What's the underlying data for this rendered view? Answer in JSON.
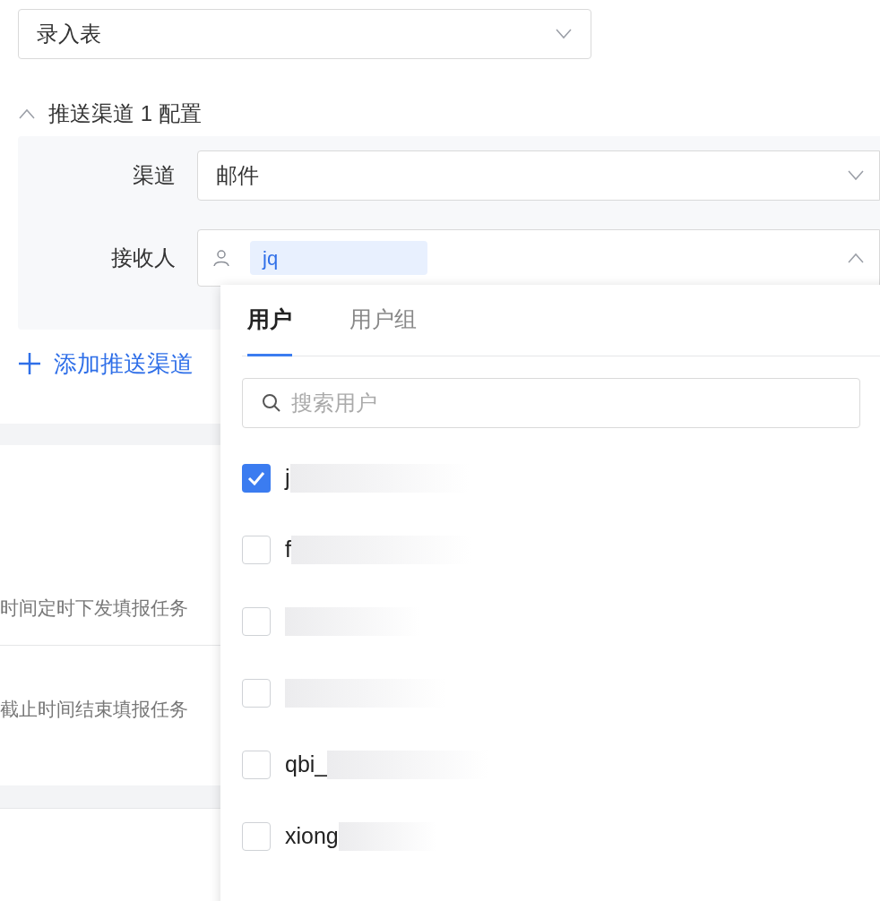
{
  "form_select": {
    "value": "录入表"
  },
  "channel_section": {
    "title": "推送渠道 1 配置",
    "expanded": true,
    "fields": [
      {
        "kind": "select",
        "label": "渠道",
        "value": "邮件"
      },
      {
        "kind": "users",
        "label": "接收人",
        "tags": [
          "jq"
        ],
        "open": true
      }
    ]
  },
  "add_channel": "添加推送渠道",
  "descriptions": [
    "时间定时下发填报任务",
    "截止时间结束填报任务"
  ],
  "dropdown": {
    "tabs": [
      {
        "label": "用户",
        "selected": true
      },
      {
        "label": "用户组",
        "selected": false
      }
    ],
    "search": {
      "placeholder": "搜索用户"
    },
    "users": [
      {
        "label": "j",
        "checked": true
      },
      {
        "label": "f",
        "checked": false
      },
      {
        "checked": false
      },
      {
        "checked": false
      },
      {
        "label": "qbi_",
        "checked": false
      },
      {
        "label": "xiong",
        "checked": false
      }
    ]
  }
}
